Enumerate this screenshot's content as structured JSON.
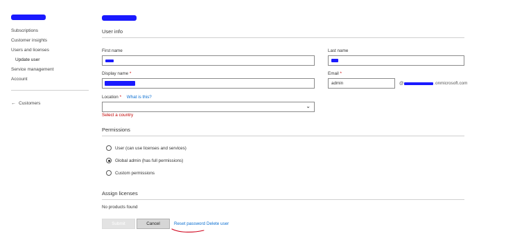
{
  "sidebar": {
    "items": [
      {
        "label": "Subscriptions"
      },
      {
        "label": "Customer insights"
      },
      {
        "label": "Users and licenses"
      },
      {
        "label": "Update user"
      },
      {
        "label": "Service management"
      },
      {
        "label": "Account"
      }
    ],
    "back_label": "Customers"
  },
  "user_info": {
    "title": "User info",
    "first_name_label": "First name",
    "last_name_label": "Last name",
    "display_name_label": "Display name",
    "email_label": "Email",
    "email_value": "admin",
    "domain_suffix": ".onmicrosoft.com",
    "domain_prefix": "@",
    "required_mark": "*",
    "location_label": "Location",
    "what_is_this": "What is this?",
    "location_error": "Select a country"
  },
  "permissions": {
    "title": "Permissions",
    "options": [
      {
        "label": "User (can use licenses and services)",
        "selected": false
      },
      {
        "label": "Global admin (has full permissions)",
        "selected": true
      },
      {
        "label": "Custom permissions",
        "selected": false
      }
    ]
  },
  "licenses": {
    "title": "Assign licenses",
    "empty_text": "No products found"
  },
  "actions": {
    "submit_label": "Submit",
    "cancel_label": "Cancel",
    "reset_password_label": "Reset password",
    "delete_user_label": "Delete user"
  },
  "colors": {
    "redaction": "#1a1aff",
    "link": "#0a6ed1",
    "error": "#c00000",
    "annotation": "#d0021b"
  }
}
